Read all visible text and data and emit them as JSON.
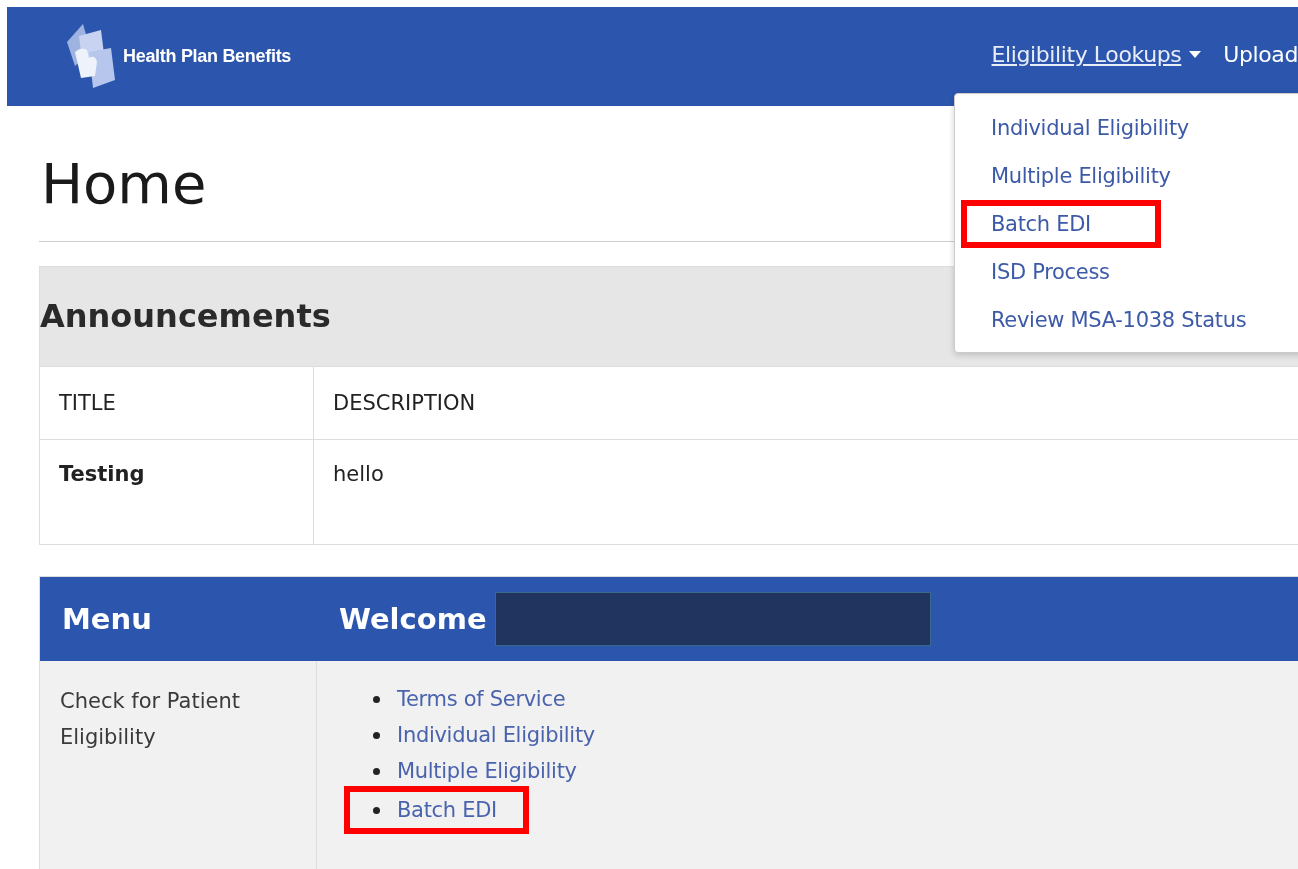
{
  "navbar": {
    "brand": "Health Plan Benefits",
    "links": [
      {
        "label": "Eligibility Lookups",
        "kind": "dropdown"
      },
      {
        "label": "Upload",
        "kind": "link"
      }
    ]
  },
  "dropdown": {
    "items": [
      {
        "label": "Individual Eligibility",
        "highlighted": false
      },
      {
        "label": "Multiple Eligibility",
        "highlighted": false
      },
      {
        "label": "Batch EDI",
        "highlighted": true
      },
      {
        "label": "ISD Process",
        "highlighted": false
      },
      {
        "label": "Review MSA-1038 Status",
        "highlighted": false
      }
    ]
  },
  "page_title": "Home",
  "announcements": {
    "heading": "Announcements",
    "columns": [
      "TITLE",
      "DESCRIPTION"
    ],
    "rows": [
      {
        "title": "Testing",
        "description": "hello"
      }
    ]
  },
  "menu_panel": {
    "menu_heading": "Menu",
    "welcome_heading": "Welcome",
    "name_redacted": true,
    "rows": [
      {
        "label": "Check for Patient Eligibility",
        "links": [
          {
            "label": "Terms of Service",
            "highlighted": false
          },
          {
            "label": "Individual Eligibility",
            "highlighted": false
          },
          {
            "label": "Multiple Eligibility",
            "highlighted": false
          },
          {
            "label": "Batch EDI",
            "highlighted": true
          }
        ]
      }
    ]
  }
}
